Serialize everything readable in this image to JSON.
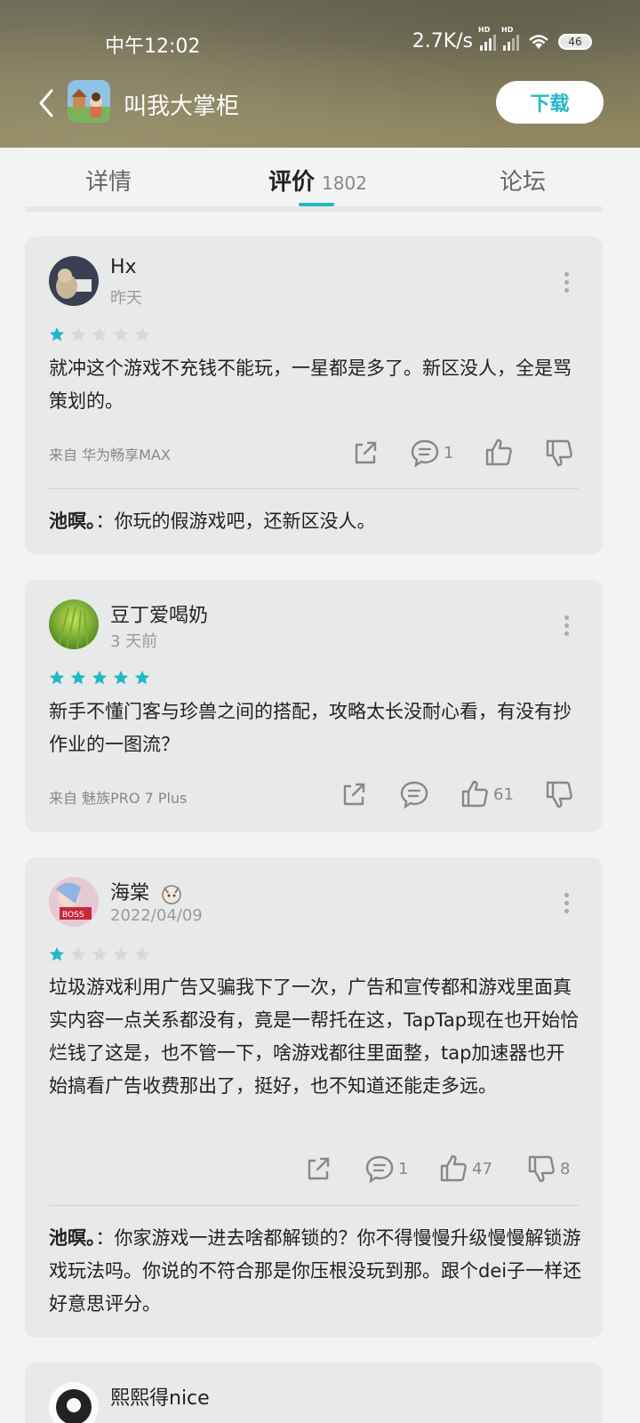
{
  "status_bar": {
    "time": "中午12:02",
    "network": "2.7K/s",
    "hd1": "HD",
    "hd2": "HD",
    "battery": "46"
  },
  "header": {
    "app_title": "叫我大掌柜",
    "download_label": "下载"
  },
  "tabs": [
    {
      "label": "详情"
    },
    {
      "label": "评价",
      "count": "1802"
    },
    {
      "label": "论坛"
    }
  ],
  "reviews": [
    {
      "username": "Hx",
      "date": "昨天",
      "rating": 1,
      "content": "就冲这个游戏不充钱不能玩，一星都是多了。新区没人，全是骂策划的。",
      "source": "来自  华为畅享MAX",
      "reply_count": "1",
      "like_count": "",
      "dislike_count": "",
      "reply": {
        "author": "池暝。",
        "text": "：你玩的假游戏吧，还新区没人。"
      }
    },
    {
      "username": "豆丁爱喝奶",
      "date": "3 天前",
      "rating": 5,
      "content": "新手不懂门客与珍兽之间的搭配，攻略太长没耐心看，有没有抄作业的一图流？",
      "source": "来自  魅族PRO 7 Plus",
      "reply_count": "",
      "like_count": "61",
      "dislike_count": ""
    },
    {
      "username": "海棠",
      "date": "2022/04/09",
      "rating": 1,
      "content": "垃圾游戏利用广告又骗我下了一次，广告和宣传都和游戏里面真实内容一点关系都没有，竟是一帮托在这，TapTap现在也开始恰烂钱了这是，也不管一下，啥游戏都往里面整，tap加速器也开始搞看广告收费那出了，挺好，也不知道还能走多远。",
      "source": "",
      "reply_count": "1",
      "like_count": "47",
      "dislike_count": "8",
      "reply": {
        "author": "池暝。",
        "text": "：你家游戏一进去啥都解锁的？你不得慢慢升级慢慢解锁游戏玩法吗。你说的不符合那是你压根没玩到那。跟个dei子一样还好意思评分。"
      }
    },
    {
      "username": "熙熙得nice"
    }
  ],
  "colors": {
    "accent": "#20b8c6",
    "star_empty": "#d8d8d8",
    "card_bg": "#e8e9e9"
  }
}
